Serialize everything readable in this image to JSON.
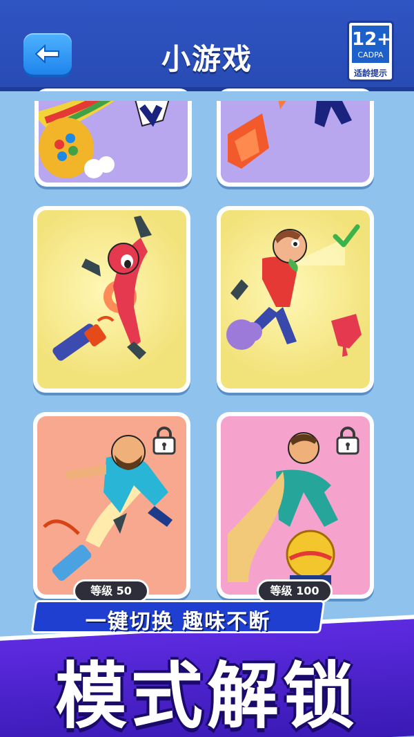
{
  "header": {
    "title": "小游戏",
    "back_icon": "arrow-left-icon",
    "age_rating": {
      "top": "12+",
      "middle": "CADPA",
      "bottom": "适龄提示"
    }
  },
  "cards": [
    {
      "id": "mode-1",
      "status": "partial"
    },
    {
      "id": "mode-2",
      "status": "partial"
    },
    {
      "id": "mode-3",
      "status": "unlocked"
    },
    {
      "id": "mode-4",
      "status": "selected",
      "icon": "checkmark-icon"
    },
    {
      "id": "mode-5",
      "status": "locked",
      "icon": "lock-icon",
      "level_label": "等级 50"
    },
    {
      "id": "mode-6",
      "status": "locked",
      "icon": "lock-icon",
      "level_label": "等级 100"
    }
  ],
  "banner": {
    "subtitle": "一键切换  趣味不断",
    "main": "模式解锁"
  },
  "colors": {
    "header": "#2f55c4",
    "background": "#8fc3ee",
    "accent_blue": "#1e84ec",
    "banner_purple": "#5d2be0",
    "check_green": "#3bb34a"
  }
}
